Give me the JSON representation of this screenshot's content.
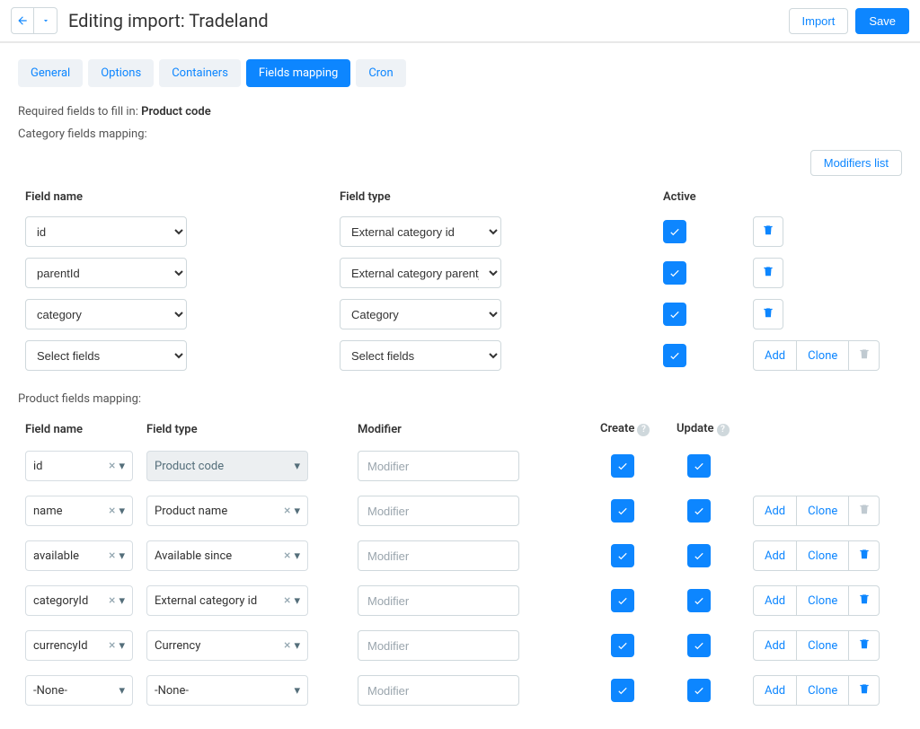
{
  "header": {
    "title": "Editing import: Tradeland",
    "import_btn": "Import",
    "save_btn": "Save"
  },
  "tabs": [
    "General",
    "Options",
    "Containers",
    "Fields mapping",
    "Cron"
  ],
  "required_label": "Required fields to fill in:",
  "required_value": "Product code",
  "category_section": "Category fields mapping:",
  "modifiers_btn": "Modifiers list",
  "cat_headers": {
    "name": "Field name",
    "type": "Field type",
    "active": "Active"
  },
  "cat_rows": [
    {
      "name": "id",
      "type": "External category id",
      "actions": "delete"
    },
    {
      "name": "parentId",
      "type": "External category parent_id",
      "actions": "delete"
    },
    {
      "name": "category",
      "type": "Category",
      "actions": "delete"
    },
    {
      "name": "Select fields",
      "type": "Select fields",
      "actions": "addclone"
    }
  ],
  "product_section": "Product fields mapping:",
  "prod_headers": {
    "name": "Field name",
    "type": "Field type",
    "modifier": "Modifier",
    "create": "Create",
    "update": "Update"
  },
  "modifier_placeholder": "Modifier",
  "add_label": "Add",
  "clone_label": "Clone",
  "none_label": "-None-",
  "prod_rows": [
    {
      "name": "id",
      "type": "Product code",
      "type_disabled": true,
      "actions": "none"
    },
    {
      "name": "name",
      "type": "Product name",
      "actions": "addclone_muted"
    },
    {
      "name": "available",
      "type": "Available since",
      "actions": "addclone"
    },
    {
      "name": "categoryId",
      "type": "External category id",
      "actions": "addclone"
    },
    {
      "name": "currencyId",
      "type": "Currency",
      "actions": "addclone"
    },
    {
      "name": "-None-",
      "type": "-None-",
      "nocross": true,
      "actions": "addclone"
    }
  ]
}
